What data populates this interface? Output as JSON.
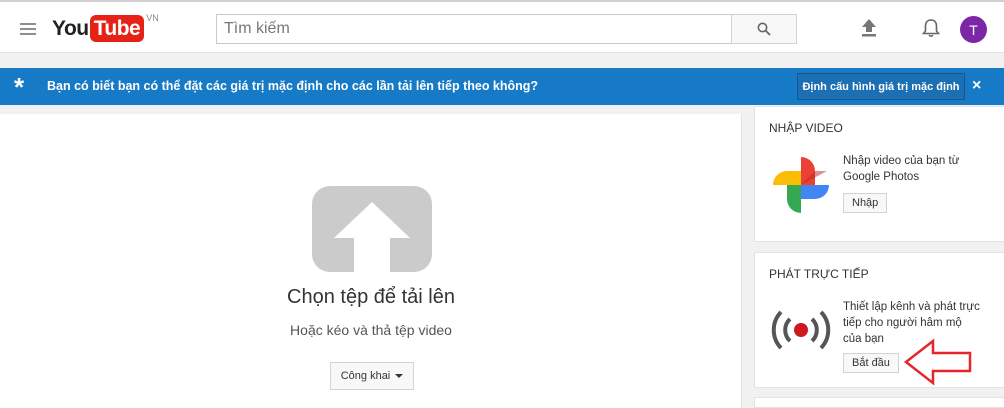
{
  "header": {
    "logo_you": "You",
    "logo_tube": "Tube",
    "logo_region": "VN",
    "search_placeholder": "Tìm kiếm",
    "avatar_letter": "T"
  },
  "banner": {
    "text": "Bạn có biết bạn có thể đặt các giá trị mặc định cho các lần tải lên tiếp theo không?",
    "button_label": "Định cấu hình giá trị mặc định",
    "close_label": "×"
  },
  "upload": {
    "title": "Chọn tệp để tải lên",
    "subtitle": "Hoặc kéo và thả tệp video",
    "privacy_label": "Công khai"
  },
  "import_card": {
    "title": "NHẬP VIDEO",
    "description": "Nhập video của bạn từ Google Photos",
    "button_label": "Nhập"
  },
  "live_card": {
    "title": "PHÁT TRỰC TIẾP",
    "description": "Thiết lập kênh và phát trực tiếp cho người hâm mộ của bạn",
    "button_label": "Bắt đầu"
  },
  "colors": {
    "brand_red": "#e62117",
    "banner_blue": "#167ac6",
    "avatar_purple": "#7b27a8",
    "annotation_red": "#e5262b"
  }
}
